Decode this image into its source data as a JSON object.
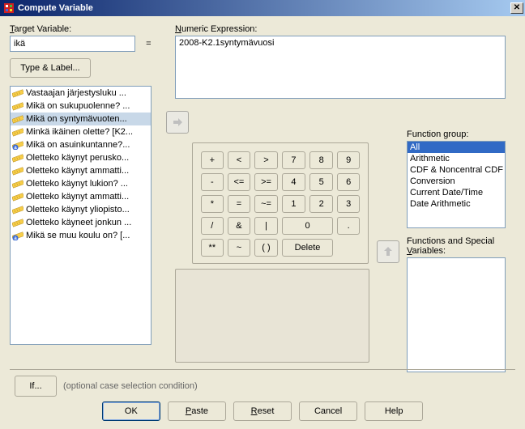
{
  "title": "Compute Variable",
  "labels": {
    "target": "Target Variable:",
    "target_access": "T",
    "expr": "Numeric Expression:",
    "expr_access": "N",
    "type_label_btn": "Type & Label...",
    "fn_group": "Function group:",
    "fn_group_access": "g",
    "fn_special": "Functions and Special Variables:",
    "fn_special_access": "V",
    "if_btn": "If...",
    "if_text": "(optional case selection condition)"
  },
  "values": {
    "target": "ikä",
    "equals": "=",
    "expr": "2008-K2.1syntymävuosi"
  },
  "variables": [
    {
      "label": "Vastaajan järjestysluku ...",
      "type": "num"
    },
    {
      "label": "Mikä on sukupuolenne? ...",
      "type": "num"
    },
    {
      "label": "Mikä on syntymävuoten...",
      "type": "num",
      "selected": true
    },
    {
      "label": "Minkä ikäinen olette? [K2...",
      "type": "num"
    },
    {
      "label": "Mikä on asuinkuntanne?...",
      "type": "str"
    },
    {
      "label": "Oletteko käynyt perusko...",
      "type": "num"
    },
    {
      "label": "Oletteko käynyt ammatti...",
      "type": "num"
    },
    {
      "label": "Oletteko käynyt lukion? ...",
      "type": "num"
    },
    {
      "label": "Oletteko käynyt ammatti...",
      "type": "num"
    },
    {
      "label": "Oletteko käynyt yliopisto...",
      "type": "num"
    },
    {
      "label": "Oletteko käyneet jonkun ...",
      "type": "num"
    },
    {
      "label": "Mikä se muu koulu on? [...",
      "type": "str"
    }
  ],
  "keypad": [
    [
      "+",
      "<",
      ">",
      "7",
      "8",
      "9"
    ],
    [
      "-",
      "<=",
      ">=",
      "4",
      "5",
      "6"
    ],
    [
      "*",
      "=",
      "~=",
      "1",
      "2",
      "3"
    ],
    [
      "/",
      "&",
      "|",
      "0_wide",
      "."
    ],
    [
      "**",
      "~",
      "( )",
      "Delete_wide",
      ""
    ]
  ],
  "fn_groups": [
    "All",
    "Arithmetic",
    "CDF & Noncentral CDF",
    "Conversion",
    "Current Date/Time",
    "Date Arithmetic"
  ],
  "fn_groups_selected": 0,
  "buttons": {
    "ok": "OK",
    "paste": "Paste",
    "reset": "Reset",
    "cancel": "Cancel",
    "help": "Help",
    "paste_access": "P",
    "reset_access": "R"
  }
}
